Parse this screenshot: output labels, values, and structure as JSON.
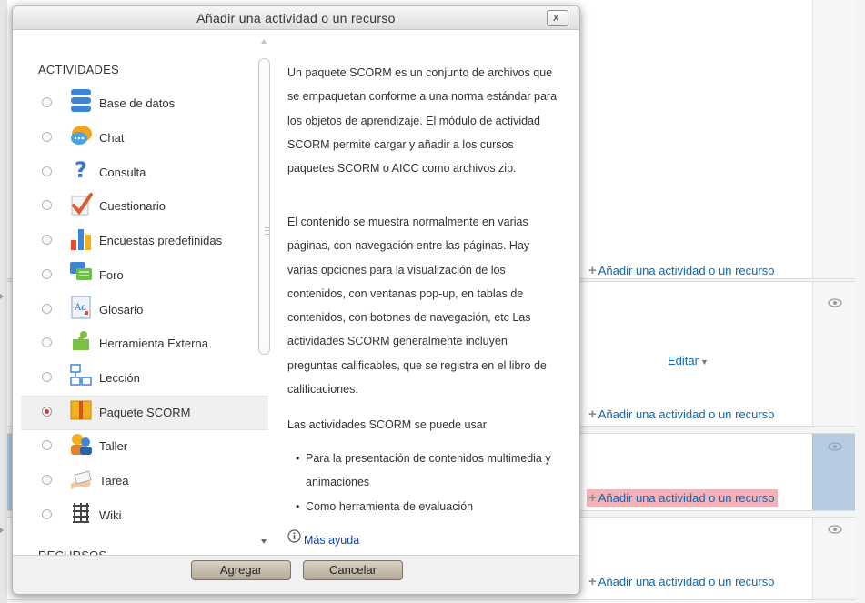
{
  "dialog": {
    "title": "Añadir una actividad o un recurso",
    "close_label": "x",
    "activities_heading": "ACTIVIDADES",
    "resources_heading": "RECURSOS",
    "options": [
      {
        "label": "Base de datos",
        "icon": "database-icon",
        "selected": false
      },
      {
        "label": "Chat",
        "icon": "chat-icon",
        "selected": false
      },
      {
        "label": "Consulta",
        "icon": "question-icon",
        "selected": false
      },
      {
        "label": "Cuestionario",
        "icon": "quiz-checkmark-icon",
        "selected": false
      },
      {
        "label": "Encuestas predefinidas",
        "icon": "bar-chart-icon",
        "selected": false
      },
      {
        "label": "Foro",
        "icon": "forum-icon",
        "selected": false
      },
      {
        "label": "Glosario",
        "icon": "glossary-icon",
        "selected": false
      },
      {
        "label": "Herramienta Externa",
        "icon": "puzzle-icon",
        "selected": false
      },
      {
        "label": "Lección",
        "icon": "lesson-icon",
        "selected": false
      },
      {
        "label": "Paquete SCORM",
        "icon": "scorm-package-icon",
        "selected": true
      },
      {
        "label": "Taller",
        "icon": "workshop-icon",
        "selected": false
      },
      {
        "label": "Tarea",
        "icon": "assignment-icon",
        "selected": false
      },
      {
        "label": "Wiki",
        "icon": "wiki-icon",
        "selected": false
      }
    ],
    "help": {
      "p1": "Un paquete SCORM es un conjunto de archivos que se empaquetan conforme a una norma estándar para los objetos de aprendizaje. El módulo de actividad SCORM permite cargar y añadir a los cursos paquetes SCORM o AICC como archivos zip.",
      "p2": "El contenido se muestra normalmente en varias páginas, con navegación entre las páginas. Hay varias opciones para la visualización de los contenidos, con ventanas pop-up, en tablas de contenidos, con botones de navegación, etc Las actividades SCORM generalmente incluyen preguntas calificables, que se registra en el libro de calificaciones.",
      "p3": "Las actividades SCORM se puede usar",
      "list": [
        "Para la presentación de contenidos multimedia y animaciones",
        "Como herramienta de evaluación"
      ],
      "more_help": "Más ayuda"
    },
    "buttons": {
      "add": "Agregar",
      "cancel": "Cancelar"
    }
  },
  "background": {
    "add_link_label": "Añadir una actividad o un recurso",
    "edit_label": "Editar",
    "highlight_color": "#f3b1b8",
    "section_highlight_color": "#b7cce2",
    "link_color": "#0a69b8"
  }
}
